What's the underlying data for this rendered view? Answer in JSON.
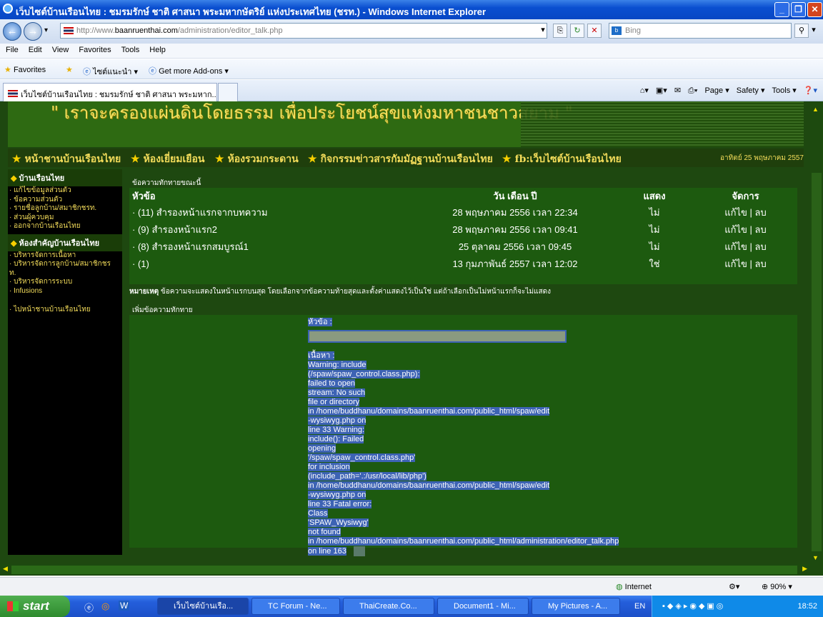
{
  "window": {
    "title": "เว็บไซต์บ้านเรือนไทย : ชมรมรักษ์ ชาติ ศาสนา พระมหากษัตริย์ แห่งประเทศไทย (ชรท.) - Windows Internet Explorer",
    "minimize": "_",
    "maximize": "❐",
    "close": "✕"
  },
  "address": {
    "scheme": "http://www.",
    "domain": "baanruenthai.com",
    "path": "/administration/editor_talk.php",
    "search_placeholder": "Bing",
    "back": "←",
    "forward": "→",
    "go": "▾",
    "refresh": "↻",
    "stop": "✕"
  },
  "menu": [
    "File",
    "Edit",
    "View",
    "Favorites",
    "Tools",
    "Help"
  ],
  "favorites": {
    "label": "Favorites",
    "item1": "ไซต์แนะนำ ▾",
    "item2": "Get more Add-ons ▾"
  },
  "tabs": {
    "active": "เว็บไซต์บ้านเรือนไทย : ชมรมรักษ์ ชาติ ศาสนา พระมหาก..."
  },
  "commands": {
    "page": "Page ▾",
    "safety": "Safety ▾",
    "tools": "Tools ▾",
    "help": "❓▾"
  },
  "banner": {
    "slogan": "\" เราจะครองแผ่นดินโดยธรรม เพื่อประโยชน์สุขแห่งมหาชนชาวสยาม \""
  },
  "nav": {
    "items": [
      "หน้าชานบ้านเรือนไทย",
      "ห้องเยี่ยมเยือน",
      "ห้องรวมกระดาน",
      "กิจกรรมข่าวสารกัมมัฏฐานบ้านเรือนไทย",
      "fb:เว็บไซต์บ้านเรือนไทย"
    ],
    "date": "อาทิตย์ 25 พฤษภาคม 2557"
  },
  "sidebar": {
    "h1": "บ้านเรือนไทย",
    "g1": [
      "แก้ไขข้อมูลส่วนตัว",
      "ข้อความส่วนตัว",
      "รายชื่อลูกบ้าน/สมาชิกชรท.",
      "ส่วนผู้ควบคุม",
      "ออกจากบ้านเรือนไทย"
    ],
    "h2": "ห้องสำคัญบ้านเรือนไทย",
    "g2": [
      "บริหารจัดการเนื้อหา",
      "บริหารจัดการลูกบ้าน/สมาชิกชร",
      "ท.",
      "บริหารจัดการระบบ",
      "Infusions"
    ],
    "g3": [
      "ไปหน้าชานบ้านเรือนไทย"
    ]
  },
  "main": {
    "section1": "ข้อความทักทายขณะนี้",
    "headers": [
      "หัวข้อ",
      "วัน เดือน ปี",
      "แสดง",
      "จัดการ"
    ],
    "rows": [
      {
        "title": "· (11) สำรองหน้าแรกจากบทความ",
        "date": "28 พฤษภาคม 2556 เวลา 22:34",
        "show": "ไม่",
        "manage": "แก้ไข | ลบ"
      },
      {
        "title": "· (9) สำรองหน้าแรก2",
        "date": "28 พฤษภาคม 2556 เวลา 09:41",
        "show": "ไม่",
        "manage": "แก้ไข | ลบ"
      },
      {
        "title": "· (8) สำรองหน้าแรกสมบูรณ์1",
        "date": "25 ตุลาคม 2556 เวลา 09:45",
        "show": "ไม่",
        "manage": "แก้ไข | ลบ"
      },
      {
        "title": "· (1)",
        "date": "13 กุมภาพันธ์ 2557 เวลา 12:02",
        "show": "ใช่",
        "manage": "แก้ไข | ลบ"
      }
    ],
    "note_label": "หมายเหตุ",
    "note": " ข้อความจะแสดงในหน้าแรกบนสุด โดยเลือกจากข้อความท้ายสุดและตั้งค่าแสดงไว้เป็นใช่ แต่ถ้าเลือกเป็นไม่หน้าแรกก็จะไม่แสดง",
    "section2": "เพิ่มข้อความทักทาย",
    "form_title_label": "หัวข้อ :",
    "form_content_label": "เนื้อหา :",
    "error_lines": [
      "Warning: include",
      "(/spaw/spaw_control.class.php):",
      "failed to open",
      "stream: No such",
      "file or directory",
      "in /home/buddhanu/domains/baanruenthai.com/public_html/spaw/edit",
      "-wysiwyg.php on",
      "line 33 Warning:",
      "include(): Failed",
      "opening",
      "'/spaw/spaw_control.class.php'",
      "for inclusion",
      "(include_path='.:/usr/local/lib/php')",
      "in /home/buddhanu/domains/baanruenthai.com/public_html/spaw/edit",
      "-wysiwyg.php on",
      "line 33 Fatal error:",
      "Class",
      "'SPAW_Wysiwyg'",
      "not found",
      "in /home/buddhanu/domains/baanruenthai.com/public_html/administration/editor_talk.php",
      "on line 163"
    ]
  },
  "status": {
    "zone": "Internet",
    "zoom": "90%"
  },
  "taskbar": {
    "start": "start",
    "tasks": [
      "เว็บไซต์บ้านเรือ...",
      "TC Forum - Ne...",
      "ThaiCreate.Co...",
      "Document1 - Mi...",
      "My Pictures - A..."
    ],
    "lang": "EN",
    "clock": "18:52"
  }
}
